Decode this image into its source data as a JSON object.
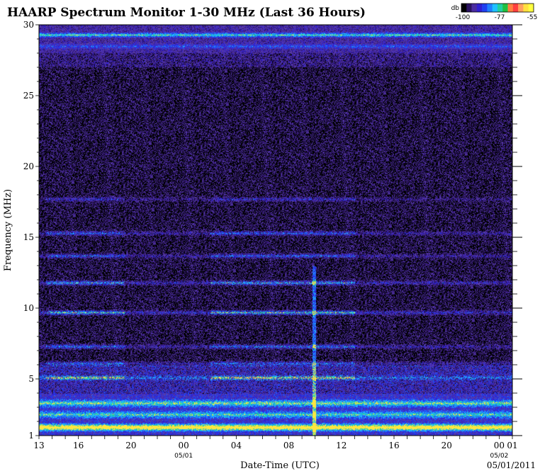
{
  "chart_data": {
    "type": "heatmap",
    "title": "HAARP Spectrum Monitor 1-30 MHz (Last 36 Hours)",
    "xlabel": "Date-Time (UTC)",
    "ylabel": "Frequency (MHz)",
    "ylim": [
      1,
      30
    ],
    "y_ticks": [
      "1",
      "5",
      "10",
      "15",
      "20",
      "25",
      "30"
    ],
    "x_hours": 36,
    "x_ticks": [
      "13",
      "16",
      "20",
      "00",
      "04",
      "08",
      "12",
      "16",
      "20",
      "00",
      "01"
    ],
    "x_date_labels": [
      {
        "hour_index": 11,
        "label": "05/01"
      },
      {
        "hour_index": 35,
        "label": "05/02"
      }
    ],
    "footer_date": "05/01/2011",
    "colorbar": {
      "unit": "db",
      "ticks": [
        "-100",
        "-77",
        "-55"
      ],
      "colors": [
        "#000000",
        "#2a1260",
        "#4a2ca0",
        "#3020d0",
        "#2040f0",
        "#2080ff",
        "#20c0ff",
        "#20d0a0",
        "#20c040",
        "#ff8040",
        "#ff4040",
        "#ffa060",
        "#ffe040",
        "#ffff40"
      ]
    },
    "bands": [
      {
        "freq_mhz": 29.3,
        "level": 0.55
      },
      {
        "freq_mhz": 28.5,
        "level": 0.25
      },
      {
        "freq_mhz": 17.7,
        "level": 0.3
      },
      {
        "freq_mhz": 15.3,
        "level": 0.45
      },
      {
        "freq_mhz": 13.7,
        "level": 0.45
      },
      {
        "freq_mhz": 11.8,
        "level": 0.6
      },
      {
        "freq_mhz": 9.7,
        "level": 0.7
      },
      {
        "freq_mhz": 7.3,
        "level": 0.5
      },
      {
        "freq_mhz": 6.1,
        "level": 0.5
      },
      {
        "freq_mhz": 5.1,
        "level": 0.55
      },
      {
        "freq_mhz": 3.3,
        "level": 0.45
      },
      {
        "freq_mhz": 2.5,
        "level": 0.4
      },
      {
        "freq_mhz": 1.6,
        "level": 0.75
      }
    ]
  }
}
